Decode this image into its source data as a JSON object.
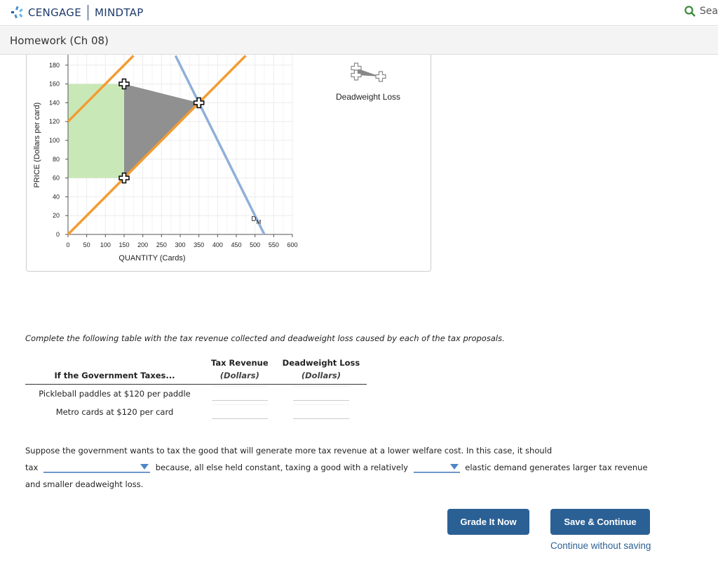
{
  "header": {
    "brand": "CENGAGE",
    "product": "MINDTAP",
    "search_label": "Sea"
  },
  "subheader": {
    "title": "Homework (Ch 08)"
  },
  "legend": {
    "deadweight_loss": "Deadweight Loss"
  },
  "chart_data": {
    "type": "line",
    "xlabel": "QUANTITY (Cards)",
    "ylabel": "PRICE (Dollars per card)",
    "xlim": [
      0,
      600
    ],
    "ylim": [
      0,
      190
    ],
    "xticks": [
      0,
      50,
      100,
      150,
      200,
      250,
      300,
      350,
      400,
      450,
      500,
      550,
      600
    ],
    "yticks": [
      0,
      20,
      40,
      60,
      80,
      100,
      120,
      140,
      160,
      180
    ],
    "grid": true,
    "series": [
      {
        "kind": "supply",
        "color": "#f39c33",
        "points": [
          [
            0,
            0
          ],
          [
            475,
            190
          ]
        ]
      },
      {
        "kind": "supply-with-tax",
        "color": "#f39c33",
        "points": [
          [
            0,
            120
          ],
          [
            175,
            190
          ]
        ]
      },
      {
        "name": "DM",
        "color": "#8fb0d8",
        "points": [
          [
            287.5,
            190
          ],
          [
            525,
            0
          ]
        ]
      }
    ],
    "tax_revenue_area": {
      "color": "#c9e8b7",
      "points": [
        [
          0,
          60
        ],
        [
          150,
          60
        ],
        [
          150,
          160
        ],
        [
          0,
          160
        ]
      ]
    },
    "deadweight_loss_area": {
      "color": "#909090",
      "points": [
        [
          150,
          160
        ],
        [
          350,
          140
        ],
        [
          150,
          60
        ]
      ]
    },
    "handles": [
      [
        150,
        160
      ],
      [
        350,
        140
      ],
      [
        150,
        60
      ]
    ],
    "curve_label": {
      "main": "D",
      "sub": "M"
    }
  },
  "instructions": "Complete the following table with the tax revenue collected and deadweight loss caused by each of the tax proposals.",
  "table": {
    "col1": "If the Government Taxes...",
    "col2": "Tax Revenue",
    "col3": "Deadweight Loss",
    "unit": "(Dollars)",
    "rows": [
      {
        "label": "Pickleball paddles at $120 per paddle",
        "revenue": "",
        "dwl": ""
      },
      {
        "label": "Metro cards at $120 per card",
        "revenue": "",
        "dwl": ""
      }
    ]
  },
  "question": {
    "line1": "Suppose the government wants to tax the good that will generate more tax revenue at a lower welfare cost. In this case, it should",
    "pre": "tax",
    "mid": "because, all else held constant, taxing a good with a relatively",
    "post": "elastic demand generates larger tax revenue",
    "line3": "and smaller deadweight loss.",
    "dropdown1": "",
    "dropdown2": ""
  },
  "buttons": {
    "grade": "Grade It Now",
    "save": "Save & Continue",
    "continue": "Continue without saving"
  },
  "colors": {
    "button": "#2b6095",
    "accent_link": "#2b6095"
  }
}
